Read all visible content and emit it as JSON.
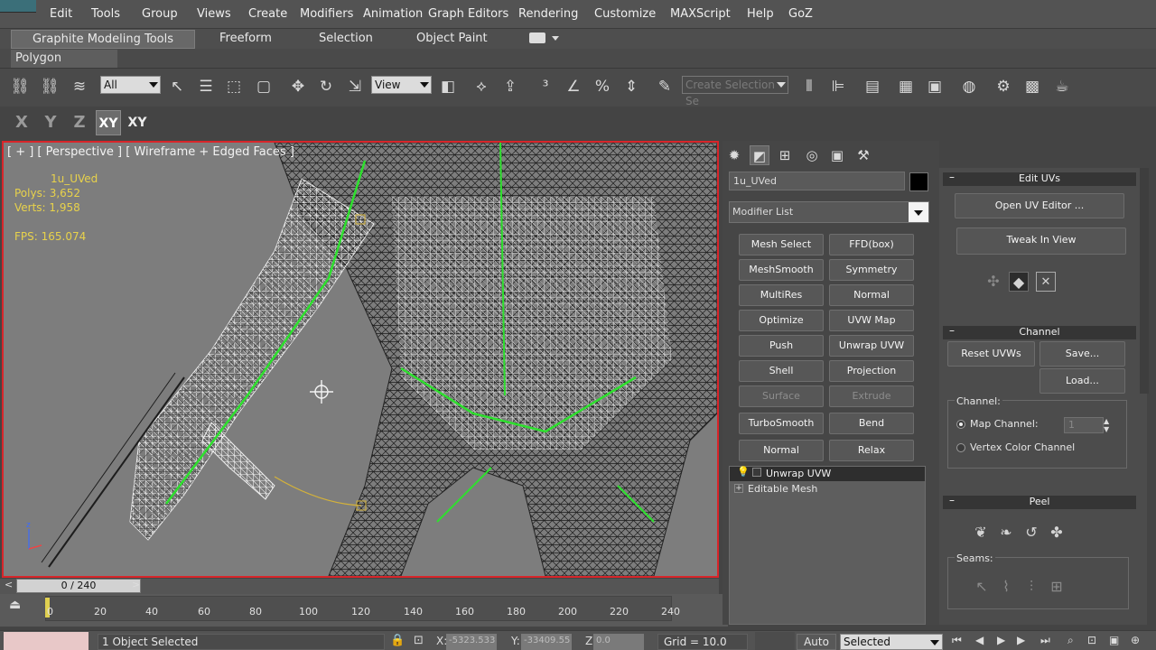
{
  "menu": [
    "Edit",
    "Tools",
    "Group",
    "Views",
    "Create",
    "Modifiers",
    "Animation",
    "Graph Editors",
    "Rendering",
    "Customize",
    "MAXScript",
    "Help",
    "GoZ"
  ],
  "ribbon": {
    "tabs": [
      "Graphite Modeling Tools",
      "Freeform",
      "Selection",
      "Object Paint"
    ],
    "subtab": "Polygon Modeling"
  },
  "toolbar": {
    "filter_value": "All",
    "refcoord_value": "View",
    "named_selection_placeholder": "Create Selection Se"
  },
  "axis": [
    "X",
    "Y",
    "Z",
    "XY",
    "XY"
  ],
  "viewport": {
    "label": "[ + ] [ Perspective ] [ Wireframe + Edged Faces ]",
    "object_name": "1u_UVed",
    "polys": "Polys: 3,652",
    "verts": "Verts: 1,958",
    "fps": "FPS: 165.074",
    "label_color": "#e8d24b",
    "border_color": "#d8252a"
  },
  "timeline": {
    "slider_label": "0 / 240",
    "ticks": [
      "0",
      "20",
      "40",
      "60",
      "80",
      "100",
      "120",
      "140",
      "160",
      "180",
      "200",
      "220",
      "240"
    ]
  },
  "status": {
    "selection": "1 Object Selected",
    "x_label": "X:",
    "x_value": "-5323.533",
    "y_label": "Y:",
    "y_value": "-33409.55",
    "z_label": "Z:",
    "z_value": "0.0",
    "grid": "Grid = 10.0",
    "auto": "Auto",
    "key_filter": "Selected"
  },
  "command_panel": {
    "object_name": "1u_UVed",
    "modifier_list": "Modifier List",
    "modifier_buttons": [
      [
        "Mesh Select",
        "FFD(box)"
      ],
      [
        "MeshSmooth",
        "Symmetry"
      ],
      [
        "MultiRes",
        "Normal"
      ],
      [
        "Optimize",
        "UVW Map"
      ],
      [
        "Push",
        "Unwrap UVW"
      ],
      [
        "Shell",
        "Projection"
      ],
      [
        "Surface",
        "Extrude"
      ],
      [
        "TurboSmooth",
        "Bend"
      ],
      [
        "Normal",
        "Relax"
      ]
    ],
    "stack": [
      "Unwrap UVW",
      "Editable Mesh"
    ]
  },
  "rollouts": {
    "edit_uvs": {
      "title": "Edit UVs",
      "open_editor": "Open UV Editor ...",
      "tweak": "Tweak In View"
    },
    "channel": {
      "title": "Channel",
      "reset": "Reset UVWs",
      "save": "Save...",
      "load": "Load...",
      "group_label": "Channel:",
      "map_channel": "Map Channel:",
      "map_value": "1",
      "vertex_color": "Vertex Color Channel"
    },
    "peel": {
      "title": "Peel",
      "seams": "Seams:"
    }
  }
}
